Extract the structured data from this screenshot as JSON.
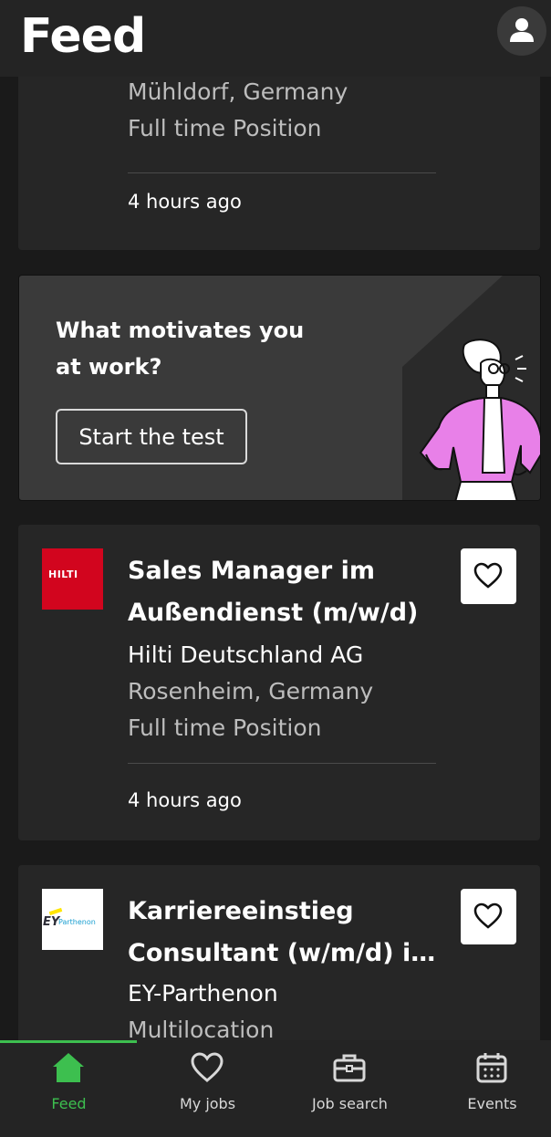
{
  "header": {
    "title": "Feed",
    "profile_icon": "user-icon"
  },
  "cards": [
    {
      "location": "Mühldorf, Germany",
      "employment": "Full time Position",
      "posted": "4 hours ago"
    },
    {
      "title": "Sales Manager im Außendienst (m/w/d)",
      "company": "Hilti Deutschland AG",
      "location": "Rosenheim, Germany",
      "employment": "Full time Position",
      "posted": "4 hours ago",
      "logo_text": "HILTI",
      "logo_color": "#d2051e"
    },
    {
      "title": "Karriereeinstieg Consultant (w/m/d) im...",
      "title_line1": "Karriereeinstieg",
      "title_line2": "Consultant (w/m/d) im...",
      "company": "EY-Parthenon",
      "location": "Multilocation",
      "logo_text_ey": "EY",
      "logo_text_brand": "Parthenon"
    }
  ],
  "promo": {
    "question": "What motivates you at work?",
    "button_label": "Start the test"
  },
  "tabs": [
    {
      "label": "Feed",
      "icon": "home-icon",
      "active": true
    },
    {
      "label": "My jobs",
      "icon": "heart-icon",
      "active": false
    },
    {
      "label": "Job search",
      "icon": "briefcase-icon",
      "active": false
    },
    {
      "label": "Events",
      "icon": "calendar-icon",
      "active": false
    }
  ],
  "colors": {
    "accent": "#3dbf4f",
    "background": "#1a1a1a",
    "card": "#262626"
  }
}
